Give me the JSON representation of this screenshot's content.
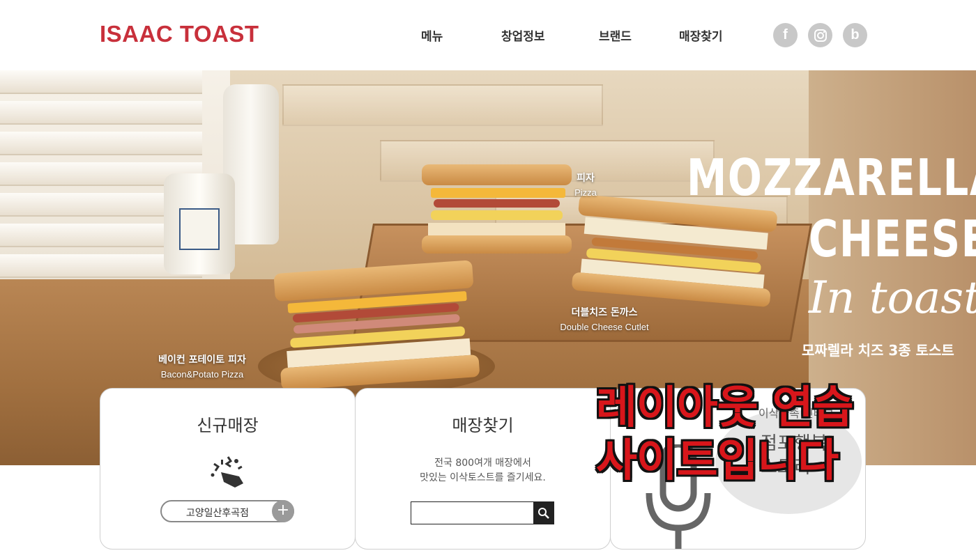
{
  "header": {
    "logo": "ISAAC TOAST",
    "nav": [
      {
        "label": "메뉴"
      },
      {
        "label": "창업정보"
      },
      {
        "label": "브랜드"
      },
      {
        "label": "매장찾기"
      }
    ],
    "social": [
      {
        "icon": "facebook-icon",
        "glyph": "f"
      },
      {
        "icon": "instagram-icon",
        "glyph": ""
      },
      {
        "icon": "blog-icon",
        "glyph": "b"
      }
    ]
  },
  "hero": {
    "headline_line1": "MOZZARELLA",
    "headline_line2": "CHEESE",
    "headline_script": "In toast",
    "subline": "모짜렐라 치즈 3종 토스트",
    "items": [
      {
        "ko": "피자",
        "en": "Pizza"
      },
      {
        "ko": "더블치즈 돈까스",
        "en": "Double Cheese Cutlet"
      },
      {
        "ko": "베이컨 포테이토 피자",
        "en": "Bacon&Potato Pizza"
      }
    ]
  },
  "cards": {
    "new_store": {
      "title": "신규매장",
      "icon": "party-popper-icon",
      "store_name": "고양일산후곡점",
      "plus": "+"
    },
    "find_store": {
      "title": "매장찾기",
      "desc_line1": "전국 800여개 매장에서",
      "desc_line2": "맛있는 이삭토스트를 즐기세요.",
      "search_value": "",
      "search_icon": "search-icon"
    },
    "podcast": {
      "subtitle": "이삭가족 인터뷰",
      "title_line1": "점포행복",
      "title_line2": "스토리",
      "icon": "microphone-icon"
    }
  },
  "overlay": {
    "line1": "레이아웃 연습",
    "line2": "사이트입니다"
  },
  "colors": {
    "brand": "#c8303b",
    "overlay_text": "#d8161b",
    "social_gray": "#c8c8c8"
  }
}
